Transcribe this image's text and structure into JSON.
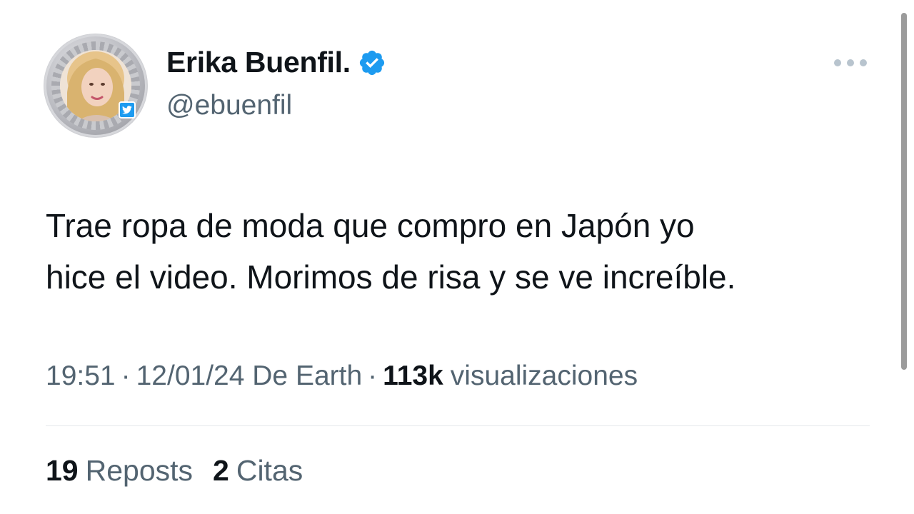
{
  "author": {
    "display_name": "Erika Buenfil.",
    "handle": "@ebuenfil",
    "verified_icon": "verified-badge-icon",
    "avatar": "profile-photo"
  },
  "tweet": {
    "text_line_1": "Trae ropa de moda que compro en Japón yo",
    "text_line_2": "hice el video. Morimos de risa y se ve increíble."
  },
  "meta": {
    "time": "19:51",
    "date_source": "12/01/24 De Earth",
    "separator": "·",
    "views_count": "113k",
    "views_label": "visualizaciones"
  },
  "stats": {
    "reposts_count": "19",
    "reposts_label": "Reposts",
    "quotes_count": "2",
    "quotes_label": "Citas"
  },
  "colors": {
    "text_primary": "#0f1419",
    "text_secondary": "#536471",
    "accent": "#1d9bf0",
    "divider": "#e4e8eb"
  }
}
